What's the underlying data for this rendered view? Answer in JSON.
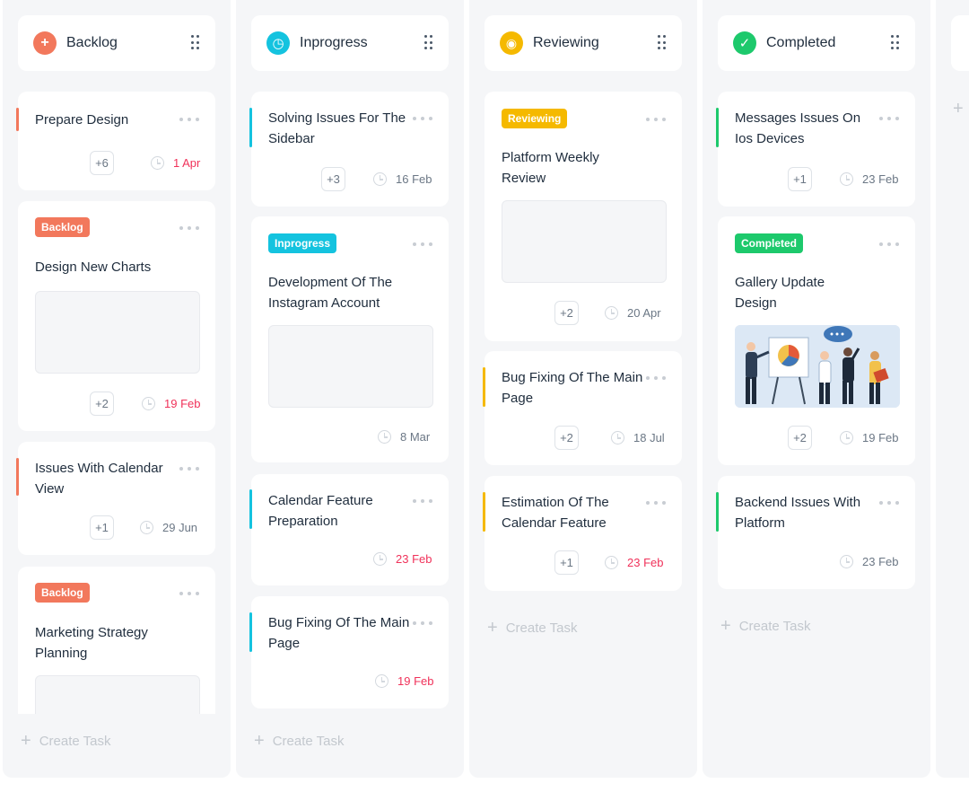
{
  "colors": {
    "backlog": "#f2785c",
    "inprogress": "#14c3df",
    "reviewing": "#f5b900",
    "completed": "#1dc96c",
    "overdue": "#f0325a"
  },
  "columns": [
    {
      "title": "Backlog",
      "icon": "plus-circle-icon",
      "icon_glyph": "+",
      "create_label": "Create Task",
      "cards": [
        {
          "title": "Prepare Design",
          "count": "+6",
          "date": "1 Apr"
        },
        {
          "badge": "Backlog",
          "title": "Design New Charts",
          "count": "+2",
          "date": "19 Feb"
        },
        {
          "title": "Issues With Calendar View",
          "count": "+1",
          "date": "29 Jun"
        },
        {
          "badge": "Backlog",
          "title": "Marketing Strategy Planning"
        }
      ]
    },
    {
      "title": "Inprogress",
      "icon": "clock-icon",
      "icon_glyph": "◷",
      "create_label": "Create Task",
      "cards": [
        {
          "title": "Solving Issues For The Sidebar",
          "count": "+3",
          "date": "16 Feb"
        },
        {
          "badge": "Inprogress",
          "title": "Development Of The Instagram Account",
          "date": "8 Mar"
        },
        {
          "title": "Calendar Feature Preparation",
          "date": "23 Feb"
        },
        {
          "title": "Bug Fixing Of The Main Page",
          "date": "19 Feb"
        }
      ]
    },
    {
      "title": "Reviewing",
      "icon": "eye-icon",
      "icon_glyph": "◉",
      "create_label": "Create Task",
      "cards": [
        {
          "badge": "Reviewing",
          "title": "Platform Weekly Review",
          "count": "+2",
          "date": "20 Apr"
        },
        {
          "title": "Bug Fixing Of The Main Page",
          "count": "+2",
          "date": "18 Jul"
        },
        {
          "title": "Estimation Of The Calendar Feature",
          "count": "+1",
          "date": "23 Feb"
        }
      ]
    },
    {
      "title": "Completed",
      "icon": "check-icon",
      "icon_glyph": "✓",
      "create_label": "Create Task",
      "cards": [
        {
          "title": "Messages Issues On Ios Devices",
          "count": "+1",
          "date": "23 Feb"
        },
        {
          "badge": "Completed",
          "title": "Gallery Update Design",
          "count": "+2",
          "date": "19 Feb"
        },
        {
          "title": "Backend Issues With Platform",
          "date": "23 Feb"
        }
      ]
    }
  ]
}
